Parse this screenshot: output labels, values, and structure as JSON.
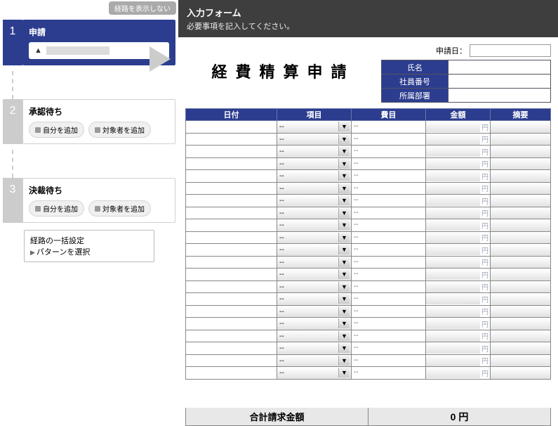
{
  "sidebar": {
    "hide_route": "経路を表示しない",
    "steps": [
      {
        "num": "1",
        "title": "申請"
      },
      {
        "num": "2",
        "title": "承認待ち"
      },
      {
        "num": "3",
        "title": "決裁待ち"
      }
    ],
    "add_self": "自分を追加",
    "add_target": "対象者を追加",
    "batch_title": "経路の一括設定",
    "batch_select": "パターンを選択"
  },
  "header": {
    "title": "入力フォーム",
    "subtitle": "必要事項を記入してください。"
  },
  "form": {
    "doc_title": "経費精算申請",
    "date_label": "申請日：",
    "date_value": "",
    "meta_labels": {
      "name": "氏名",
      "empno": "社員番号",
      "dept": "所属部署"
    },
    "meta_values": {
      "name": "",
      "empno": "",
      "dept": ""
    }
  },
  "columns": {
    "date": "日付",
    "item": "項目",
    "expense": "費目",
    "amount": "金額",
    "desc": "摘要"
  },
  "row_defaults": {
    "item_display": "--",
    "expense_display": "--",
    "yen": "円"
  },
  "row_count": 21,
  "total": {
    "label": "合計請求金額",
    "value": "0 円"
  }
}
